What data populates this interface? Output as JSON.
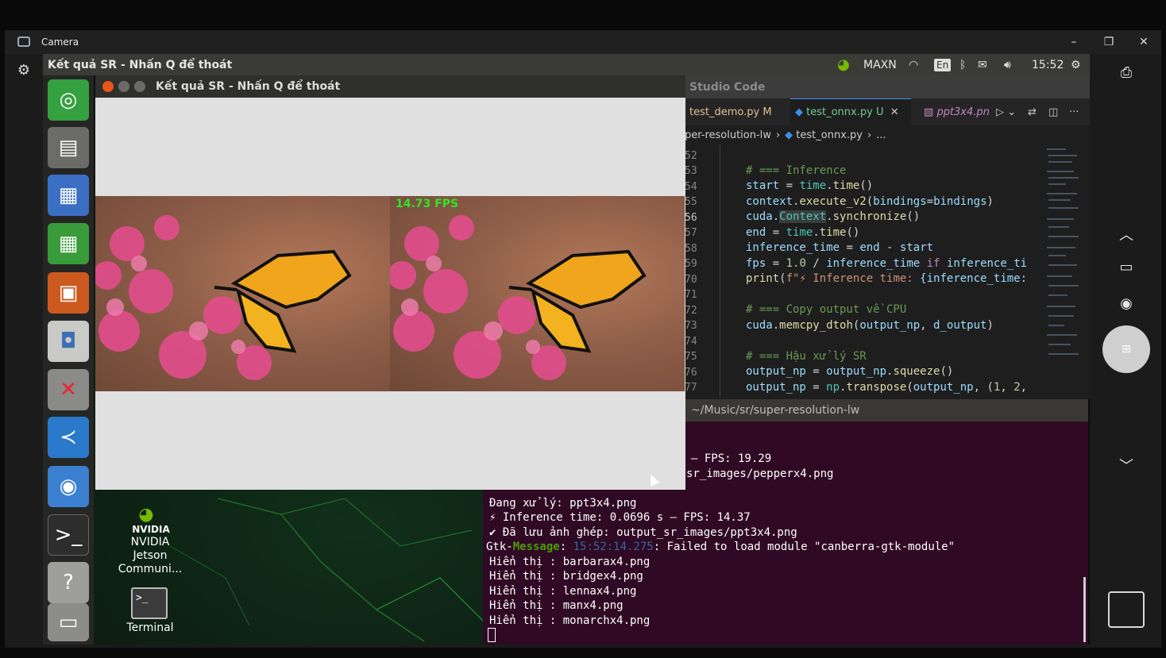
{
  "camera": {
    "title": "Camera",
    "window_controls": [
      "minimize-icon",
      "restore-icon",
      "close-icon"
    ],
    "side_buttons": [
      "settings-icon",
      "camera-switch-icon",
      "chevron-up-icon",
      "video-icon",
      "photo-icon",
      "qr-icon",
      "chevron-down-icon"
    ]
  },
  "panel": {
    "title": "Kết quả SR - Nhấn Q để thoát",
    "power_mode": "MAXN",
    "keyboard": "En",
    "clock": "15:52",
    "tray_icons": [
      "nvidia-icon",
      "wifi-icon",
      "bluetooth-icon",
      "mail-icon",
      "volume-icon",
      "settings-icon"
    ]
  },
  "launcher": {
    "items": [
      "dash-icon",
      "files-icon",
      "writer-icon",
      "calc-icon",
      "impress-icon",
      "software-icon",
      "system-settings-icon",
      "vscode-icon",
      "chromium-icon",
      "terminal-icon",
      "help-icon",
      "drive-icon"
    ]
  },
  "desktop_icons": {
    "nvidia": "NVIDIA\nJetson\nCommuni...",
    "nvidia_logo": "NVIDIA",
    "terminal": "Terminal"
  },
  "sr_window": {
    "title": "Kết quả SR - Nhấn Q để thoát",
    "fps_overlay": "14.73 FPS"
  },
  "vscode": {
    "title": "Studio Code",
    "tabs": [
      {
        "label": "test_demo.py",
        "badge": "M"
      },
      {
        "label": "test_onnx.py",
        "badge": "U"
      },
      {
        "label": "ppt3x4.pn"
      }
    ],
    "breadcrumb": [
      "per-resolution-lw",
      "test_onnx.py",
      "..."
    ],
    "line_numbers": [
      "52",
      "53",
      "54",
      "55",
      "56",
      "57",
      "58",
      "59",
      "70",
      "71",
      "72",
      "73",
      "74",
      "75",
      "76",
      "77"
    ],
    "code": {
      "l53": "# === Inference",
      "l54_a": "start",
      "l54_b": " = ",
      "l54_c": "time",
      "l54_d": ".",
      "l54_e": "time",
      "l54_f": "()",
      "l55_a": "context",
      "l55_b": ".",
      "l55_c": "execute_v2",
      "l55_d": "(",
      "l55_e": "bindings",
      "l55_f": "=",
      "l55_g": "bindings",
      "l55_h": ")",
      "l56_a": "cuda",
      "l56_b": ".",
      "l56_c": "Context",
      "l56_d": ".",
      "l56_e": "synchronize",
      "l56_f": "()",
      "l57_a": "end",
      "l57_b": " = ",
      "l57_c": "time",
      "l57_d": ".",
      "l57_e": "time",
      "l57_f": "()",
      "l58_a": "inference_time",
      "l58_b": " = ",
      "l58_c": "end",
      "l58_d": " - ",
      "l58_e": "start",
      "l59_a": "fps",
      "l59_b": " = ",
      "l59_c": "1.0",
      "l59_d": " / ",
      "l59_e": "inference_time",
      "l59_f": " if ",
      "l59_g": "inference_ti",
      "l70_a": "print",
      "l70_b": "(",
      "l70_c": "f\"⚡ Inference time: ",
      "l70_d": "{inference_time:",
      "l72": "# === Copy output về CPU",
      "l73_a": "cuda",
      "l73_b": ".",
      "l73_c": "memcpy_dtoh",
      "l73_d": "(",
      "l73_e": "output_np",
      "l73_f": ", ",
      "l73_g": "d_output",
      "l73_h": ")",
      "l75": "# === Hậu xử lý SR",
      "l76_a": "output_np",
      "l76_b": " = ",
      "l76_c": "output_np",
      "l76_d": ".",
      "l76_e": "squeeze",
      "l76_f": "()",
      "l77_a": "output_np",
      "l77_b": " = ",
      "l77_c": "np",
      "l77_d": ".",
      "l77_e": "transpose",
      "l77_f": "(",
      "l77_g": "output_np",
      "l77_h": ", (",
      "l77_i": "1",
      "l77_j": ", ",
      "l77_k": "2",
      "l77_l": ","
    }
  },
  "terminal": {
    "title": "~/Music/sr/super-resolution-lw",
    "lines": {
      "fps": "— FPS: 19.29",
      "saved1": "sr_images/pepperx4.png",
      "processing": "Đang xử lý: ppt3x4.png",
      "inference": "⚡ Inference time: 0.0696 s — FPS: 14.37",
      "saved2": "✔ Đã lưu ảnh ghép: output_sr_images/ppt3x4.png",
      "gtk_prefix": "Gtk-",
      "gtk_word": "Message",
      "gtk_colon": ": ",
      "gtk_time": "15:52:14.275",
      "gtk_msg": ": Failed to load module \"canberra-gtk-module\"",
      "show1": "Hiển thị : barbarax4.png",
      "show2": "Hiển thị : bridgex4.png",
      "show3": "Hiển thị : lennax4.png",
      "show4": "Hiển thị : manx4.png",
      "show5": "Hiển thị : monarchx4.png"
    }
  }
}
